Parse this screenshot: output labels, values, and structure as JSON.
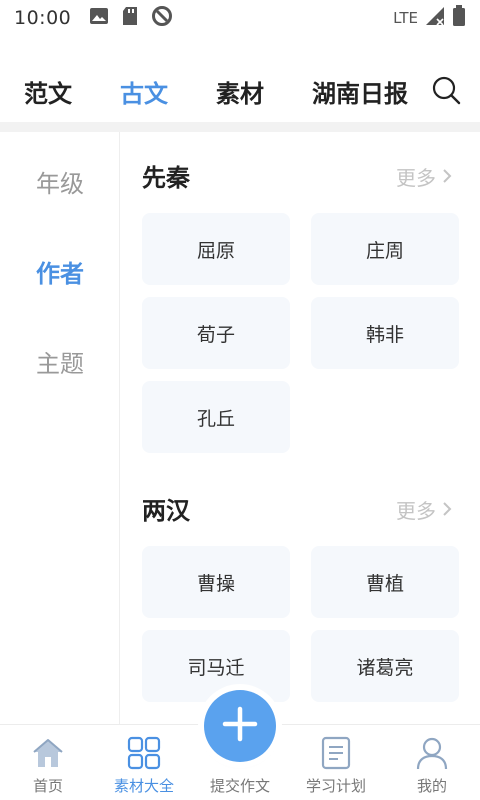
{
  "status_bar": {
    "time": "10:00",
    "network": "LTE",
    "icons": [
      "image-icon",
      "sd-card-icon",
      "data-saver-icon",
      "signal-icon",
      "battery-icon"
    ]
  },
  "top_tabs": {
    "items": [
      {
        "label": "范文"
      },
      {
        "label": "古文"
      },
      {
        "label": "素材"
      },
      {
        "label": "湖南日报"
      }
    ],
    "active_index": 1,
    "search_icon": "search-icon"
  },
  "left_nav": {
    "items": [
      {
        "label": "年级"
      },
      {
        "label": "作者"
      },
      {
        "label": "主题"
      }
    ],
    "active_index": 1
  },
  "sections": [
    {
      "title": "先秦",
      "more_label": "更多",
      "authors": [
        "屈原",
        "庄周",
        "荀子",
        "韩非",
        "孔丘"
      ]
    },
    {
      "title": "两汉",
      "more_label": "更多",
      "authors": [
        "曹操",
        "曹植",
        "司马迁",
        "诸葛亮"
      ]
    }
  ],
  "bottom_nav": {
    "items": [
      {
        "label": "首页",
        "icon": "home-icon"
      },
      {
        "label": "素材大全",
        "icon": "grid-icon"
      },
      {
        "label": "提交作文",
        "icon": "add-icon"
      },
      {
        "label": "学习计划",
        "icon": "plan-icon"
      },
      {
        "label": "我的",
        "icon": "profile-icon"
      }
    ],
    "active_index": 1
  },
  "colors": {
    "accent": "#4a90e2",
    "fab": "#5aa2ee",
    "card_bg": "#f5f8fc",
    "muted_text": "#999999"
  }
}
